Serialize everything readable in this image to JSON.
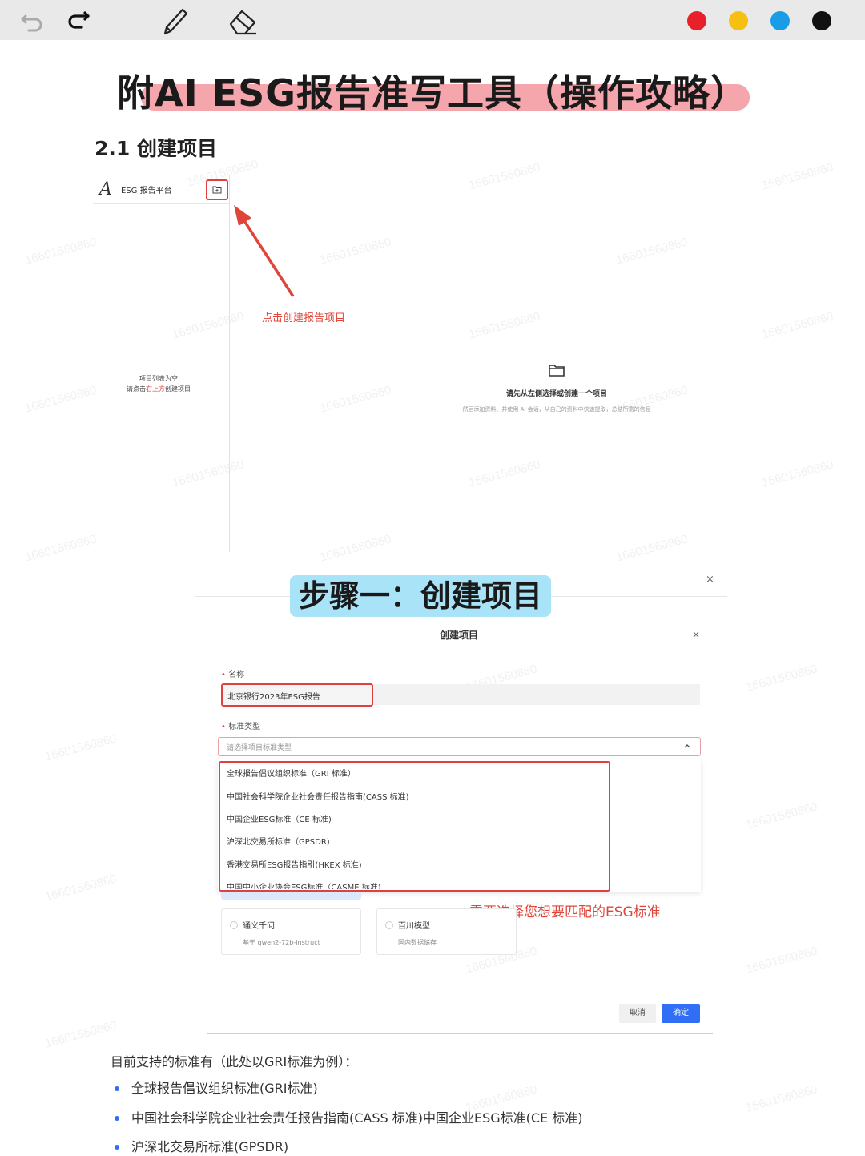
{
  "toolbar": {
    "tools": [
      "undo-icon",
      "redo-icon",
      "pencil-icon",
      "eraser-icon"
    ],
    "colors": [
      "#e8202a",
      "#f5c010",
      "#1a9de8",
      "#111111"
    ]
  },
  "title": "附AI ESG报告准写工具（操作攻略）",
  "section_title": "2.1 创建项目",
  "screenshot1": {
    "platform_name": "ESG 报告平台",
    "annotation": "点击创建报告项目",
    "empty_list_line1": "项目列表为空",
    "empty_list_prefix": "请点击",
    "empty_list_accent": "右上方",
    "empty_list_suffix": "创建项目",
    "main_hint": "请先从左侧选择或创建一个项目",
    "main_sub": "然后添加资料、并使用 AI 会话，从自己的资料中快速提取，总结所需的信息"
  },
  "step_banner": "步骤一：创建项目",
  "dialog": {
    "title": "创建项目",
    "close": "×",
    "outer_close": "×",
    "name_label": "名称",
    "name_value": "北京银行2023年ESG报告",
    "standard_label": "标准类型",
    "standard_placeholder": "请选择项目标准类型",
    "options": [
      "全球报告倡议组织标准（GRI 标准）",
      "中国社会科学院企业社会责任报告指南(CASS 标准)",
      "中国企业ESG标准（CE 标准)",
      "沪深北交易所标准（GPSDR)",
      "香港交易所ESG报告指引(HKEX 标准)",
      "中国中小企业协会ESG标准（CASME 标准)"
    ],
    "note": "需要选择您想要匹配的ESG标准",
    "models": [
      {
        "name": "通义千问",
        "desc": "基于 qwen2-72b-instruct"
      },
      {
        "name": "百川模型",
        "desc": "国内数据储存"
      }
    ],
    "cancel": "取消",
    "ok": "确定"
  },
  "intro": "目前支持的标准有（此处以GRI标准为例）：",
  "bullets": [
    "全球报告倡议组织标准(GRI标准)",
    "中国社会科学院企业社会责任报告指南(CASS 标准)中国企业ESG标准(CE 标准)",
    "沪深北交易所标准(GPSDR)"
  ],
  "watermark": "16601560860"
}
